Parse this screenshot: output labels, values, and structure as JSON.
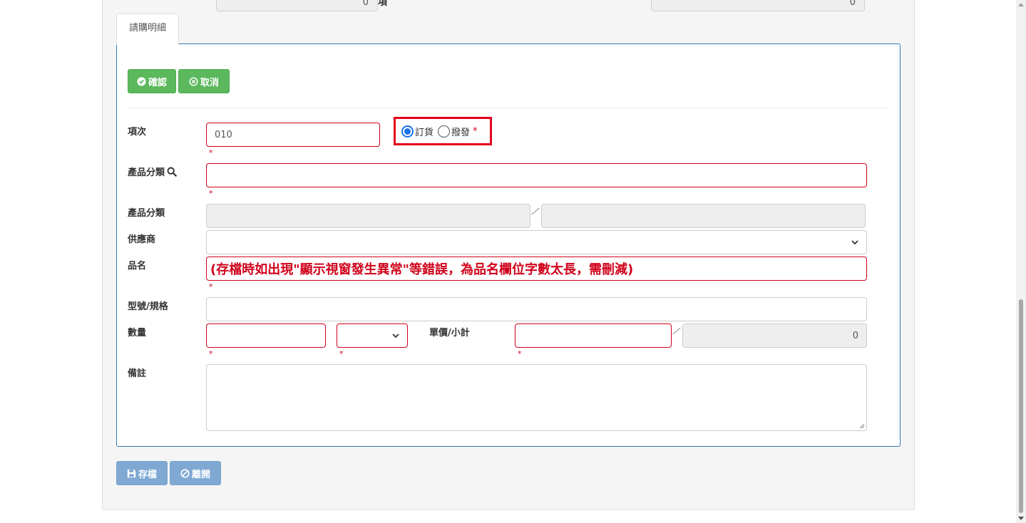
{
  "top_row": {
    "left_value": "0",
    "label_fragment": "項",
    "right_value": "0"
  },
  "tab": {
    "label": "請購明細"
  },
  "actions": {
    "confirm": "確認",
    "cancel": "取消"
  },
  "form": {
    "item_no": {
      "label": "項次",
      "value": "010",
      "required": "*"
    },
    "order_type": {
      "options": [
        "訂貨",
        "撥發"
      ],
      "selected": "訂貨",
      "required": "*"
    },
    "category_search": {
      "label": "產品分類",
      "value": "",
      "required": "*"
    },
    "category_readonly": {
      "label": "產品分類",
      "code": "",
      "name": ""
    },
    "supplier": {
      "label": "供應商",
      "selected": ""
    },
    "product_name": {
      "label": "品名",
      "value": "(存檔時如出現\"顯示視窗發生異常\"等錯誤，為品名欄位字數太長，需刪減)",
      "required": "*"
    },
    "model_spec": {
      "label": "型號/規格",
      "value": ""
    },
    "quantity": {
      "label": "數量",
      "value": "",
      "unit": "",
      "required": "*"
    },
    "price": {
      "label": "單價/小計",
      "unit_price": "",
      "subtotal": "0",
      "required": "*"
    },
    "remarks": {
      "label": "備註",
      "value": ""
    }
  },
  "footer": {
    "save": "存檔",
    "leave": "離開"
  },
  "colors": {
    "accent": "#337ab7",
    "success": "#5cb85c",
    "error": "#d0021b",
    "highlight": "#e3001b"
  }
}
